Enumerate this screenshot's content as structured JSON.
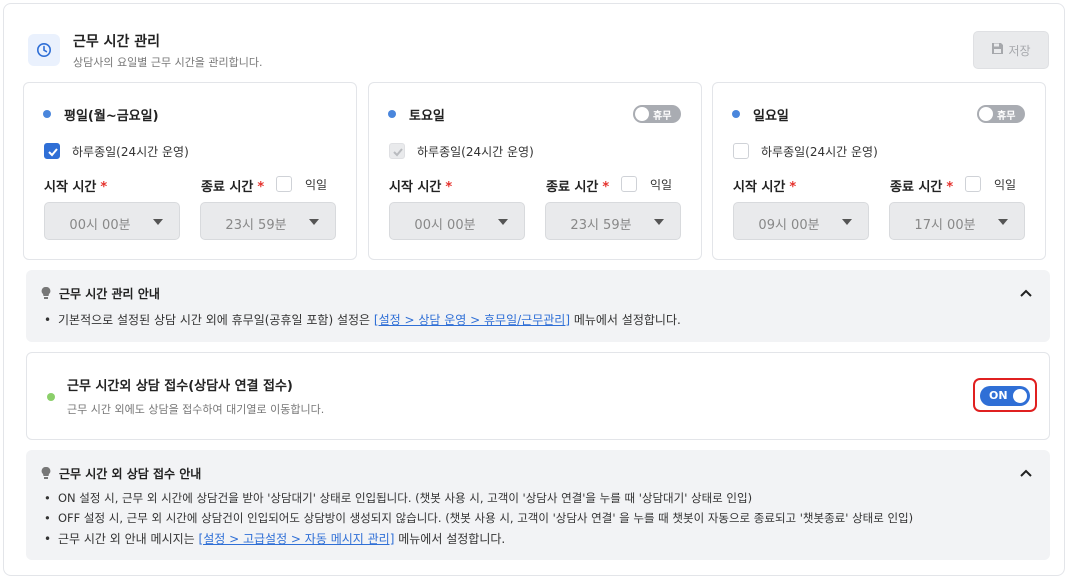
{
  "header": {
    "title": "근무 시간 관리",
    "subtitle": "상담사의 요일별 근무 시간을 관리합니다.",
    "save_label": "저장"
  },
  "days": [
    {
      "name": "평일(월~금요일)",
      "has_toggle": false,
      "all_day_checked": true,
      "all_day_label": "하루종일(24시간 운영)",
      "start_label": "시작 시간",
      "end_label": "종료 시간",
      "next_day_label": "익일",
      "start_value": "00시 00분",
      "end_value": "23시 59분"
    },
    {
      "name": "토요일",
      "has_toggle": true,
      "toggle_label": "휴무",
      "all_day_checked": true,
      "all_day_label": "하루종일(24시간 운영)",
      "start_label": "시작 시간",
      "end_label": "종료 시간",
      "next_day_label": "익일",
      "start_value": "00시 00분",
      "end_value": "23시 59분"
    },
    {
      "name": "일요일",
      "has_toggle": true,
      "toggle_label": "휴무",
      "all_day_checked": false,
      "all_day_label": "하루종일(24시간 운영)",
      "start_label": "시작 시간",
      "end_label": "종료 시간",
      "next_day_label": "익일",
      "start_value": "09시 00분",
      "end_value": "17시 00분"
    }
  ],
  "guide1": {
    "title": "근무 시간 관리 안내",
    "line_prefix": "기본적으로 설정된 상담 시간 외에 휴무일(공휴일 포함) 설정은 ",
    "line_link": "[설정 > 상담 운영 > 휴무일/근무관리]",
    "line_suffix": " 메뉴에서 설정합니다."
  },
  "consult": {
    "title": "근무 시간외 상담 접수(상담사 연결 접수)",
    "subtitle": "근무 시간 외에도 상담을 접수하여 대기열로 이동합니다.",
    "toggle_label": "ON"
  },
  "guide2": {
    "title": "근무 시간 외 상담 접수 안내",
    "line1": "ON 설정 시, 근무 외 시간에 상담건을 받아 '상담대기' 상태로 인입됩니다. (챗봇 사용 시, 고객이 '상담사 연결'을 누를 때 '상담대기' 상태로 인입)",
    "line2": "OFF 설정 시, 근무 외 시간에 상담건이 인입되어도 상담방이 생성되지 않습니다. (챗봇 사용 시, 고객이 '상담사 연결' 을 누를 때 챗봇이 자동으로 종료되고 '챗봇종료' 상태로 인입)",
    "line3_prefix": "근무 시간 외 안내 메시지는 ",
    "line3_link": "[설정 > 고급설정 > 자동 메시지 관리]",
    "line3_suffix": " 메뉴에서 설정합니다."
  },
  "colors": {
    "accent": "#2f6fd6",
    "required": "#e5322d",
    "highlight": "#e02020",
    "status_green": "#8bcf6a"
  }
}
